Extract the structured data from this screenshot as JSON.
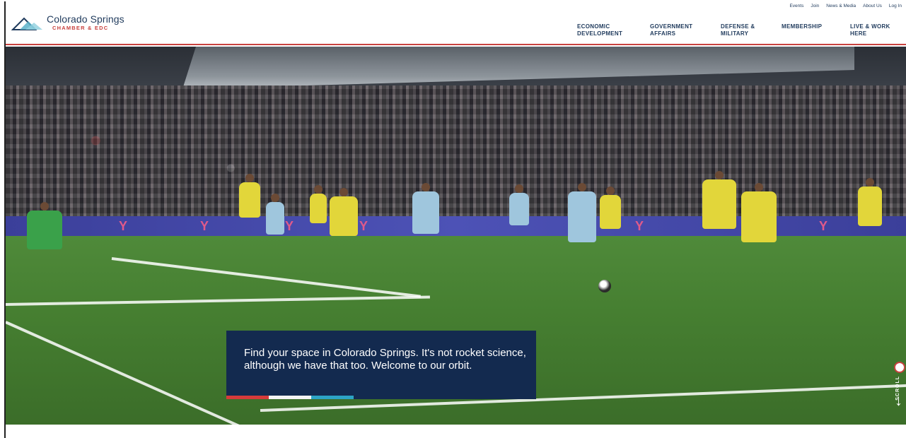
{
  "brand": {
    "title": "Colorado Springs",
    "subtitle": "CHAMBER & EDC"
  },
  "utility_nav": [
    "Events",
    "Join",
    "News & Media",
    "About Us",
    "Log In"
  ],
  "main_nav": [
    {
      "line1": "ECONOMIC",
      "line2": "DEVELOPMENT"
    },
    {
      "line1": "GOVERNMENT",
      "line2": "AFFAIRS"
    },
    {
      "line1": "DEFENSE &",
      "line2": "MILITARY"
    },
    {
      "line1": "MEMBERSHIP",
      "line2": ""
    },
    {
      "line1": "LIVE & WORK",
      "line2": "HERE"
    }
  ],
  "hero": {
    "caption": "Find your space in Colorado Springs. It's not rocket science, although we have that too. Welcome to our orbit.",
    "scroll_label": "SCROLL",
    "scroll_arrow": "↓",
    "accent_colors": [
      "#d63b3b",
      "#f4f4f4",
      "#2da4c5"
    ]
  },
  "colors": {
    "navy": "#132a4f",
    "brand_red": "#c8423f",
    "text_blue": "#1f3a5c"
  },
  "icons": {
    "logo": "mountain-logo-icon",
    "scroll": "arrow-down-icon"
  }
}
